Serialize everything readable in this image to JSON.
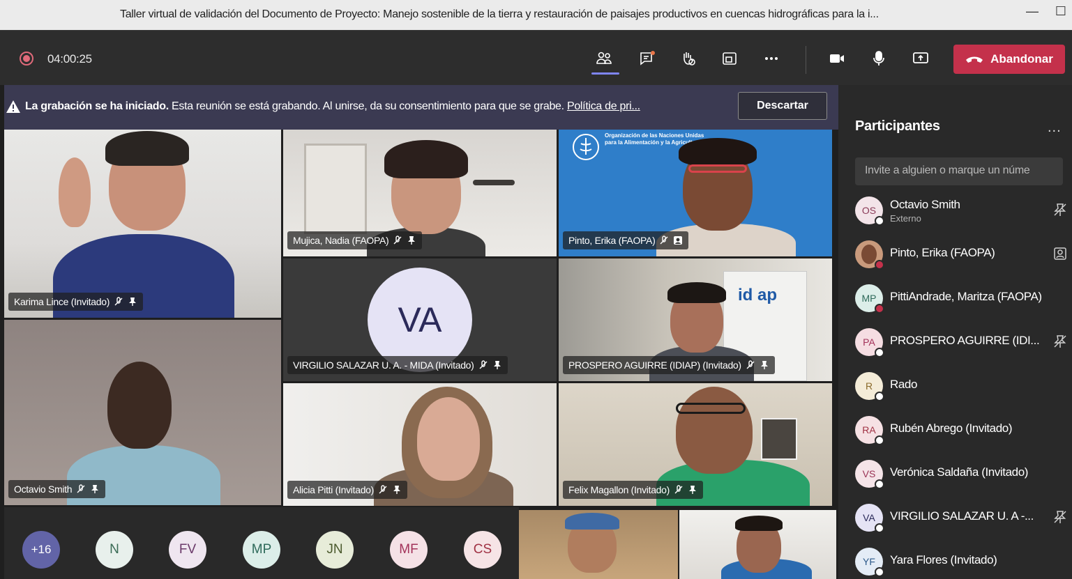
{
  "window": {
    "title": "Taller virtual de validación del Documento de Proyecto: Manejo sostenible de la tierra y restauración de paisajes productivos en cuencas hidrográficas para la i...",
    "minimize": "—",
    "maximize": "☐"
  },
  "toolbar": {
    "timer": "04:00:25",
    "leave_label": "Abandonar"
  },
  "banner": {
    "bold": "La grabación se ha iniciado.",
    "text": "Esta reunión se está grabando. Al unirse, da su consentimiento para que se grabe.",
    "link": "Política de pri...",
    "dismiss": "Descartar"
  },
  "tiles": {
    "karima": "Karima Lince (Invitado)",
    "nadia": "Mujica, Nadia (FAOPA)",
    "erika": "Pinto, Erika (FAOPA)",
    "virgilio_initials": "VA",
    "virgilio": "VIRGILIO SALAZAR U. A. - MIDA (Invitado)",
    "prospero": "PROSPERO AGUIRRE (IDIAP) (Invitado)",
    "octavio": "Octavio Smith",
    "alicia": "Alicia Pitti (Invitado)",
    "felix": "Felix Magallon (Invitado)",
    "fao_logo_text": "Organización de las Naciones Unidas para la Alimentación y la Agricultura",
    "idiap_logo": "id ap"
  },
  "overflow": {
    "more_count": "+16",
    "avatars": [
      "N",
      "FV",
      "MP",
      "JN",
      "MF",
      "CS"
    ]
  },
  "panel": {
    "heading": "Participantes",
    "more": "...",
    "invite_placeholder": "Invite a alguien o marque un núme",
    "participants": [
      {
        "initials": "OS",
        "name": "Octavio Smith",
        "sub": "Externo"
      },
      {
        "initials": "",
        "name": "Pinto, Erika (FAOPA)",
        "sub": ""
      },
      {
        "initials": "MP",
        "name": "PittiAndrade, Maritza (FAOPA)",
        "sub": ""
      },
      {
        "initials": "PA",
        "name": "PROSPERO AGUIRRE (IDI...",
        "sub": ""
      },
      {
        "initials": "R",
        "name": "Rado",
        "sub": ""
      },
      {
        "initials": "RA",
        "name": "Rubén Abrego (Invitado)",
        "sub": ""
      },
      {
        "initials": "VS",
        "name": "Verónica Saldaña (Invitado)",
        "sub": ""
      },
      {
        "initials": "VA",
        "name": "VIRGILIO SALAZAR U. A -...",
        "sub": ""
      },
      {
        "initials": "YF",
        "name": "Yara Flores (Invitado)",
        "sub": ""
      }
    ]
  },
  "colors": {
    "accent": "#7f85f5",
    "leave": "#c4314b",
    "recording": "#e06a7a",
    "banner": "#3b3a52"
  }
}
